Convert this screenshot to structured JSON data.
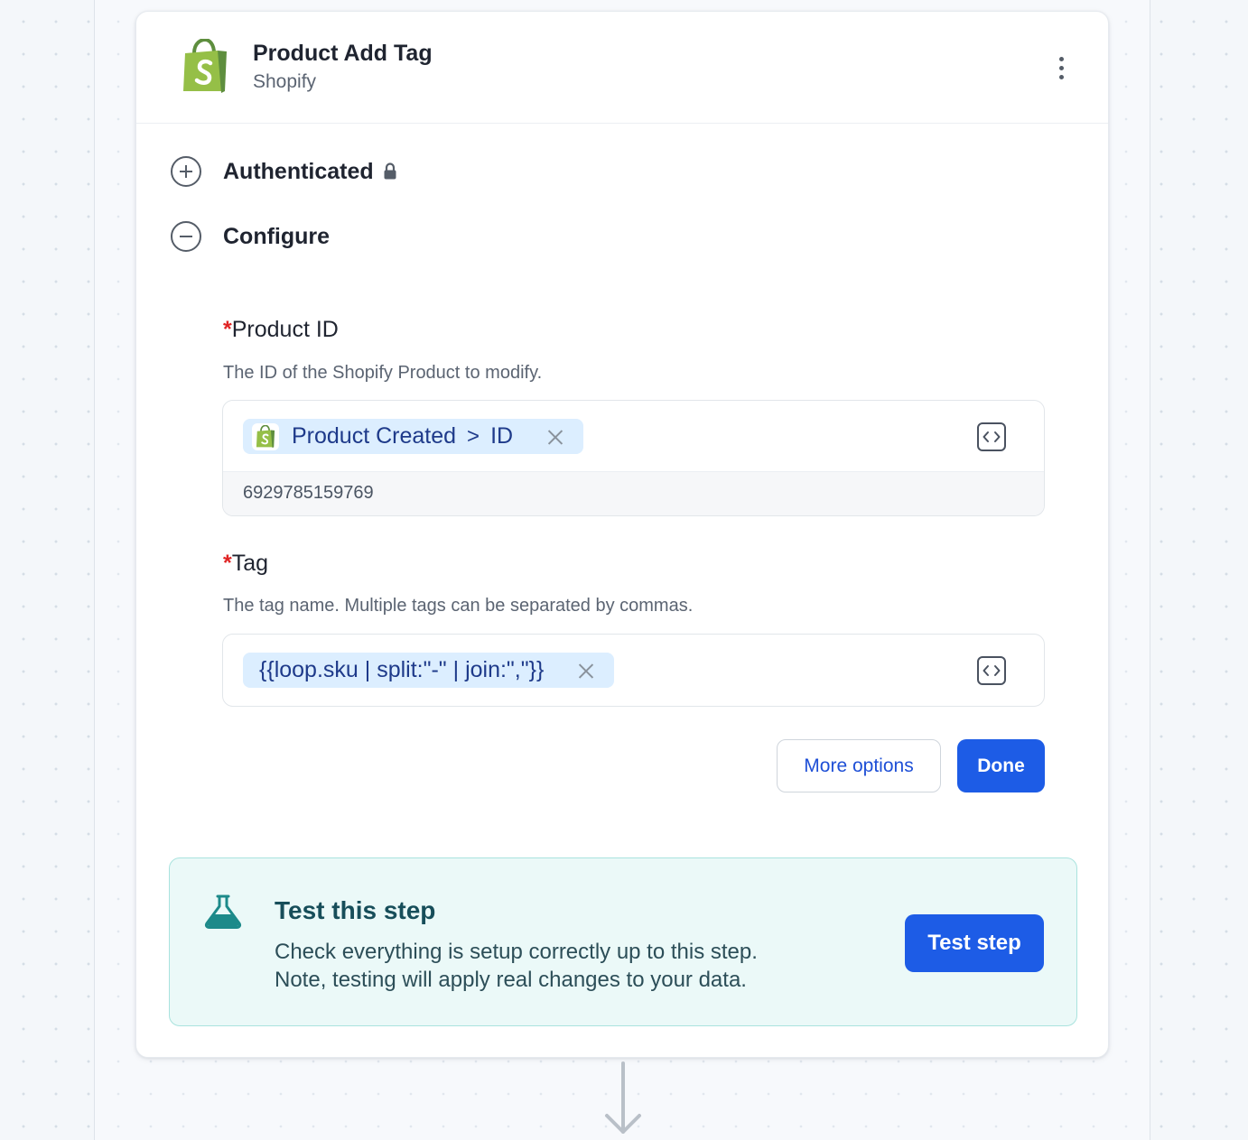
{
  "step": {
    "title": "Product Add Tag",
    "app_name": "Shopify",
    "brand_color": "#95bf47"
  },
  "sections": {
    "authenticated": {
      "label": "Authenticated",
      "icon": "plus-circle-icon",
      "lock_icon": "lock-icon"
    },
    "configure": {
      "label": "Configure",
      "icon": "minus-circle-icon"
    }
  },
  "fields": {
    "product_id": {
      "required_mark": "*",
      "label": "Product ID",
      "help": "The ID of the Shopify Product to modify.",
      "chip": {
        "source": "Product Created",
        "separator": ">",
        "key": "ID"
      },
      "preview_value": "6929785159769"
    },
    "tag": {
      "required_mark": "*",
      "label": "Tag",
      "help": "The tag name. Multiple tags can be separated by commas.",
      "chip": {
        "expression": "{{loop.sku | split:\"-\" | join:\",\"}}"
      }
    }
  },
  "actions": {
    "more_options": "More options",
    "done": "Done"
  },
  "test_panel": {
    "title": "Test this step",
    "description_line1": "Check everything is setup correctly up to this step.",
    "description_line2": "Note, testing will apply real changes to your data.",
    "button": "Test step",
    "accent_color": "#1d8a8a"
  },
  "colors": {
    "primary": "#1d5ce6",
    "required": "#e02424",
    "chip_bg": "#dceeff"
  }
}
